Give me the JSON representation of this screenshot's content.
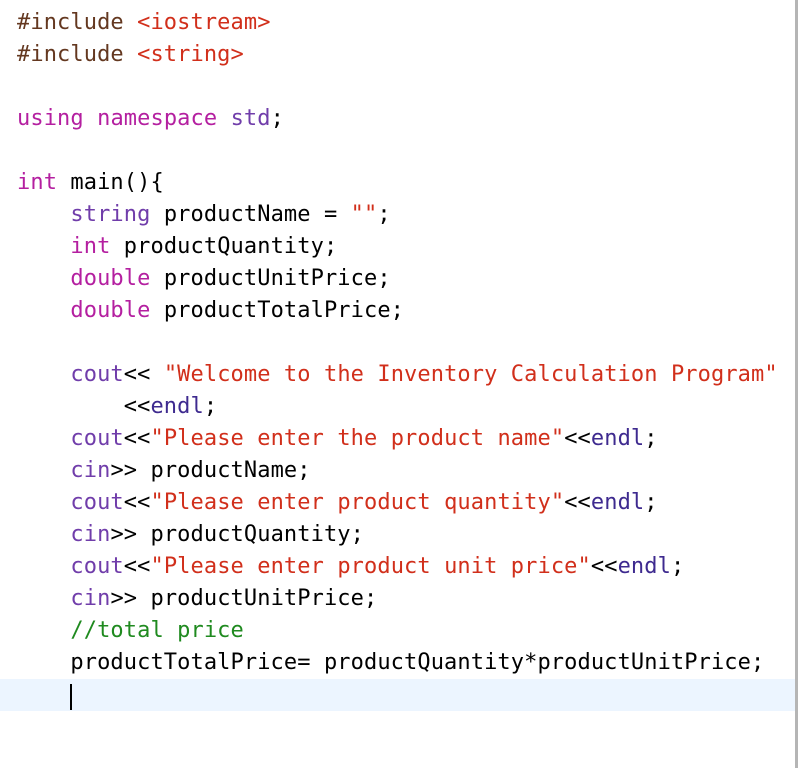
{
  "editor": {
    "language": "C++",
    "lines": [
      {
        "tokens": [
          {
            "t": "#include ",
            "c": "pp"
          },
          {
            "t": "<iostream>",
            "c": "str"
          }
        ]
      },
      {
        "tokens": [
          {
            "t": "#include ",
            "c": "pp"
          },
          {
            "t": "<string>",
            "c": "str"
          }
        ]
      },
      {
        "tokens": []
      },
      {
        "tokens": [
          {
            "t": "using",
            "c": "kw"
          },
          {
            "t": " "
          },
          {
            "t": "namespace",
            "c": "kw"
          },
          {
            "t": " "
          },
          {
            "t": "std",
            "c": "type"
          },
          {
            "t": ";"
          }
        ]
      },
      {
        "tokens": []
      },
      {
        "tokens": [
          {
            "t": "int",
            "c": "kw"
          },
          {
            "t": " main(){"
          }
        ]
      },
      {
        "tokens": [
          {
            "t": "    "
          },
          {
            "t": "string",
            "c": "type"
          },
          {
            "t": " productName = "
          },
          {
            "t": "\"\"",
            "c": "str"
          },
          {
            "t": ";"
          }
        ]
      },
      {
        "tokens": [
          {
            "t": "    "
          },
          {
            "t": "int",
            "c": "kw"
          },
          {
            "t": " productQuantity;"
          }
        ]
      },
      {
        "tokens": [
          {
            "t": "    "
          },
          {
            "t": "double",
            "c": "kw"
          },
          {
            "t": " productUnitPrice;"
          }
        ]
      },
      {
        "tokens": [
          {
            "t": "    "
          },
          {
            "t": "double",
            "c": "kw"
          },
          {
            "t": " productTotalPrice;"
          }
        ]
      },
      {
        "tokens": []
      },
      {
        "tokens": [
          {
            "t": "    "
          },
          {
            "t": "cout",
            "c": "type"
          },
          {
            "t": "<< "
          },
          {
            "t": "\"Welcome to the Inventory Calculation Program\"",
            "c": "str"
          }
        ]
      },
      {
        "tokens": [
          {
            "t": "        <<"
          },
          {
            "t": "endl",
            "c": "fn"
          },
          {
            "t": ";"
          }
        ]
      },
      {
        "tokens": [
          {
            "t": "    "
          },
          {
            "t": "cout",
            "c": "type"
          },
          {
            "t": "<<"
          },
          {
            "t": "\"Please enter the product name\"",
            "c": "str"
          },
          {
            "t": "<<"
          },
          {
            "t": "endl",
            "c": "fn"
          },
          {
            "t": ";"
          }
        ]
      },
      {
        "tokens": [
          {
            "t": "    "
          },
          {
            "t": "cin",
            "c": "type"
          },
          {
            "t": ">> productName;"
          }
        ]
      },
      {
        "tokens": [
          {
            "t": "    "
          },
          {
            "t": "cout",
            "c": "type"
          },
          {
            "t": "<<"
          },
          {
            "t": "\"Please enter product quantity\"",
            "c": "str"
          },
          {
            "t": "<<"
          },
          {
            "t": "endl",
            "c": "fn"
          },
          {
            "t": ";"
          }
        ]
      },
      {
        "tokens": [
          {
            "t": "    "
          },
          {
            "t": "cin",
            "c": "type"
          },
          {
            "t": ">> productQuantity;"
          }
        ]
      },
      {
        "tokens": [
          {
            "t": "    "
          },
          {
            "t": "cout",
            "c": "type"
          },
          {
            "t": "<<"
          },
          {
            "t": "\"Please enter product unit price\"",
            "c": "str"
          },
          {
            "t": "<<"
          },
          {
            "t": "endl",
            "c": "fn"
          },
          {
            "t": ";"
          }
        ]
      },
      {
        "tokens": [
          {
            "t": "    "
          },
          {
            "t": "cin",
            "c": "type"
          },
          {
            "t": ">> productUnitPrice;"
          }
        ]
      },
      {
        "tokens": [
          {
            "t": "    "
          },
          {
            "t": "//total price",
            "c": "cmt"
          }
        ]
      },
      {
        "tokens": [
          {
            "t": "    productTotalPrice= productQuantity*productUnitPrice;"
          }
        ]
      },
      {
        "tokens": [
          {
            "t": "    "
          }
        ],
        "current": true
      }
    ]
  },
  "colors": {
    "keyword": "#b41fa0",
    "type": "#703daa",
    "preprocessor": "#643820",
    "string": "#d12f1b",
    "comment": "#1f8a1f",
    "current_line": "#ecf5ff"
  }
}
